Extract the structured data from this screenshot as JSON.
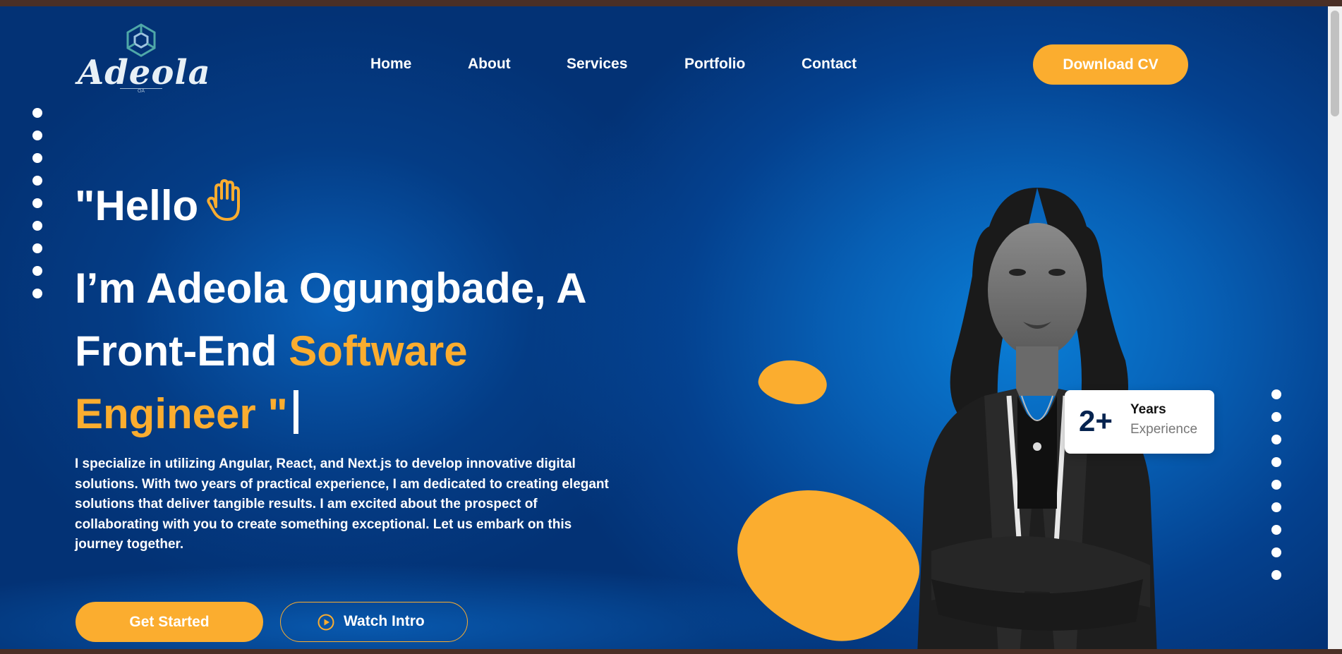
{
  "brand": {
    "name": "Adeola",
    "sub": "OA"
  },
  "nav": [
    {
      "label": "Home"
    },
    {
      "label": "About"
    },
    {
      "label": "Services"
    },
    {
      "label": "Portfolio"
    },
    {
      "label": "Contact"
    }
  ],
  "header": {
    "cv_button": "Download CV"
  },
  "hero": {
    "greeting": "\"Hello",
    "headline_pre": "I’m Adeola Ogungbade, A Front-End ",
    "headline_accent": "Software Engineer \"",
    "description": "I specialize in utilizing Angular, React, and Next.js to develop innovative digital solutions. With two years of practical experience, I am dedicated to creating elegant solutions that deliver tangible results. I am excited about the prospect of collaborating with you to create something exceptional. Let us embark on this journey together.",
    "primary_button": "Get Started",
    "secondary_button": "Watch Intro"
  },
  "experience": {
    "value": "2+",
    "title": "Years",
    "label": "Experience"
  },
  "icons": {
    "hand": "hand-wave-icon",
    "play": "play-circle-icon"
  },
  "colors": {
    "accent": "#fbad2f",
    "background": "#04418f",
    "text": "#ffffff"
  }
}
